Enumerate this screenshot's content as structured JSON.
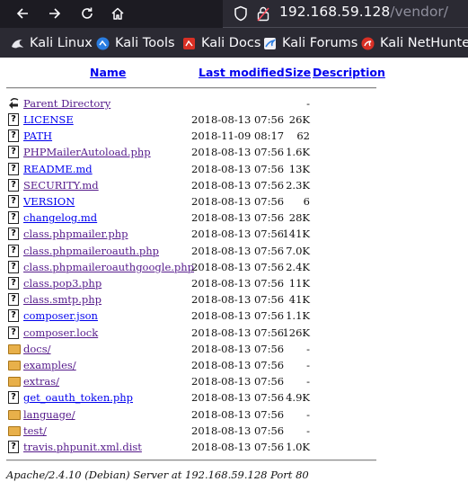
{
  "browser": {
    "url_host": "192.168.59.128",
    "url_path": "/vendor/",
    "bookmarks": [
      {
        "label": "Kali Linux",
        "icon": "kali-dragon-icon"
      },
      {
        "label": "Kali Tools",
        "icon": "kali-tools-icon"
      },
      {
        "label": "Kali Docs",
        "icon": "kali-docs-icon"
      },
      {
        "label": "Kali Forums",
        "icon": "kali-forums-icon"
      },
      {
        "label": "Kali NetHunter",
        "icon": "kali-nethunter-icon"
      }
    ]
  },
  "listing": {
    "headers": {
      "name": "Name",
      "modified": "Last modified",
      "size": "Size",
      "description": "Description"
    },
    "parent": {
      "label": "Parent Directory",
      "size": "-"
    },
    "entries": [
      {
        "name": "LICENSE",
        "date": "2018-08-13 07:56",
        "size": "26K",
        "type": "file"
      },
      {
        "name": "PATH",
        "date": "2018-11-09 08:17",
        "size": "62",
        "type": "file"
      },
      {
        "name": "PHPMailerAutoload.php",
        "date": "2018-08-13 07:56",
        "size": "1.6K",
        "type": "file"
      },
      {
        "name": "README.md",
        "date": "2018-08-13 07:56",
        "size": "13K",
        "type": "file"
      },
      {
        "name": "SECURITY.md",
        "date": "2018-08-13 07:56",
        "size": "2.3K",
        "type": "file"
      },
      {
        "name": "VERSION",
        "date": "2018-08-13 07:56",
        "size": "6",
        "type": "file"
      },
      {
        "name": "changelog.md",
        "date": "2018-08-13 07:56",
        "size": "28K",
        "type": "file"
      },
      {
        "name": "class.phpmailer.php",
        "date": "2018-08-13 07:56",
        "size": "141K",
        "type": "file"
      },
      {
        "name": "class.phpmaileroauth.php",
        "date": "2018-08-13 07:56",
        "size": "7.0K",
        "type": "file"
      },
      {
        "name": "class.phpmaileroauthgoogle.php",
        "date": "2018-08-13 07:56",
        "size": "2.4K",
        "type": "file"
      },
      {
        "name": "class.pop3.php",
        "date": "2018-08-13 07:56",
        "size": "11K",
        "type": "file"
      },
      {
        "name": "class.smtp.php",
        "date": "2018-08-13 07:56",
        "size": "41K",
        "type": "file"
      },
      {
        "name": "composer.json",
        "date": "2018-08-13 07:56",
        "size": "1.1K",
        "type": "file"
      },
      {
        "name": "composer.lock",
        "date": "2018-08-13 07:56",
        "size": "126K",
        "type": "file"
      },
      {
        "name": "docs/",
        "date": "2018-08-13 07:56",
        "size": "-",
        "type": "folder"
      },
      {
        "name": "examples/",
        "date": "2018-08-13 07:56",
        "size": "-",
        "type": "folder"
      },
      {
        "name": "extras/",
        "date": "2018-08-13 07:56",
        "size": "-",
        "type": "folder"
      },
      {
        "name": "get_oauth_token.php",
        "date": "2018-08-13 07:56",
        "size": "4.9K",
        "type": "file"
      },
      {
        "name": "language/",
        "date": "2018-08-13 07:56",
        "size": "-",
        "type": "folder"
      },
      {
        "name": "test/",
        "date": "2018-08-13 07:56",
        "size": "-",
        "type": "folder"
      },
      {
        "name": "travis.phpunit.xml.dist",
        "date": "2018-08-13 07:56",
        "size": "1.0K",
        "type": "file"
      }
    ]
  },
  "footer": "Apache/2.4.10 (Debian) Server at 192.168.59.128 Port 80"
}
